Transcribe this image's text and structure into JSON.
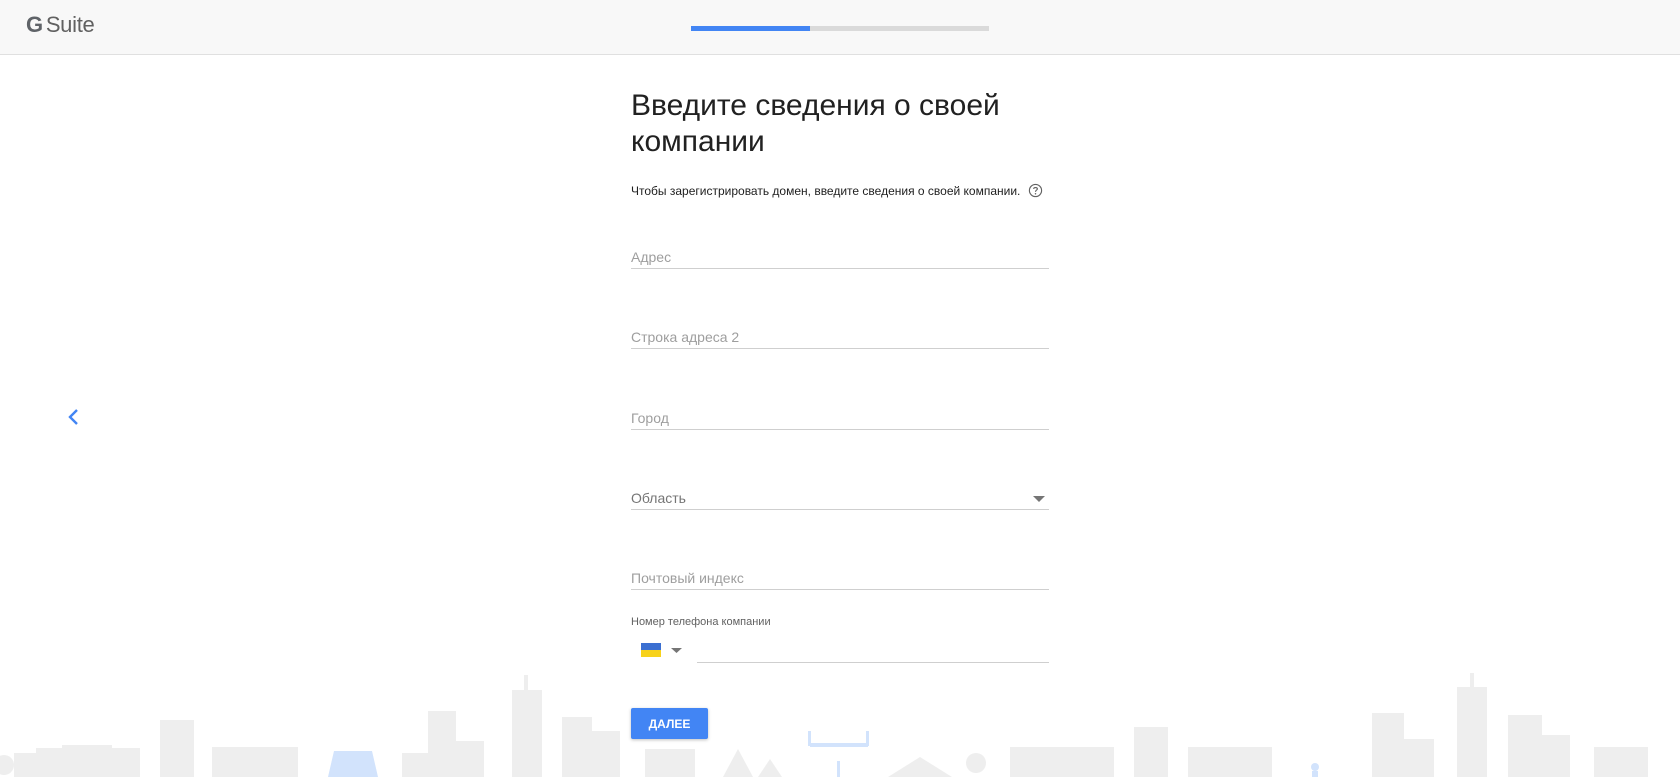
{
  "header": {
    "logo_g": "G",
    "logo_text": "Suite",
    "progress": 0.4
  },
  "nav": {
    "back_icon": "chevron-left-icon"
  },
  "form": {
    "title_line1": "Введите сведения о своей",
    "title_line2": "компании",
    "subtitle": "Чтобы зарегистрировать домен, введите сведения о своей компании.",
    "help_icon": "help-circle-icon",
    "address_placeholder": "Адрес",
    "address2_placeholder": "Строка адреса 2",
    "city_placeholder": "Город",
    "region_label": "Область",
    "postal_placeholder": "Почтовый индекс",
    "phone_label": "Номер телефона компании",
    "phone_country_icon": "ukraine-flag-icon",
    "phone_value": "",
    "next_button": "ДАЛЕЕ"
  },
  "colors": {
    "accent": "#4285f4",
    "progress_track": "#dadada",
    "skyline": "#eeeeee",
    "skyline_blue": "#d2e3fc"
  }
}
